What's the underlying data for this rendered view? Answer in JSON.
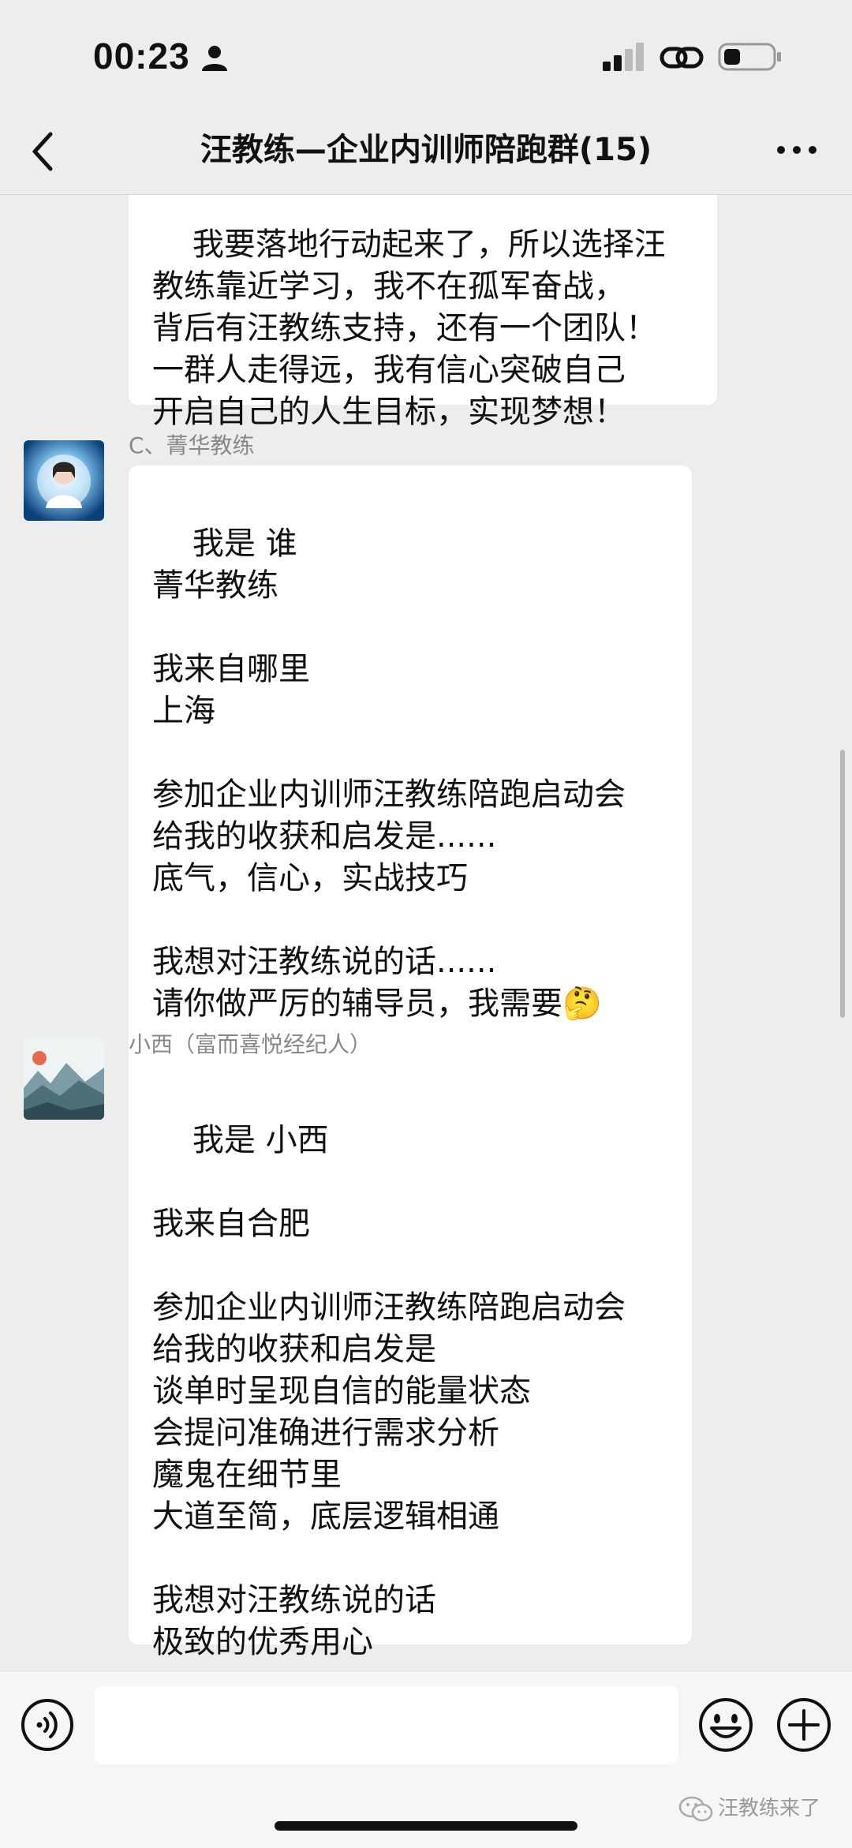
{
  "status_bar": {
    "time": "00:23",
    "icons": [
      "person-icon",
      "signal-icon",
      "link-icon",
      "battery-icon"
    ]
  },
  "nav": {
    "title": "汪教练—企业内训师陪跑群(15)",
    "icons": [
      "back-chevron-icon",
      "more-icon"
    ]
  },
  "messages": [
    {
      "sender": "",
      "text": "我要落地行动起来了，所以选择汪\n教练靠近学习，我不在孤军奋战，\n背后有汪教练支持，还有一个团队！\n一群人走得远，我有信心突破自己\n开启自己的人生目标，实现梦想！"
    },
    {
      "sender": "C、菁华教练",
      "text": "我是 谁\n菁华教练\n\n我来自哪里\n上海\n\n参加企业内训师汪教练陪跑启动会\n给我的收获和启发是......\n底气，信心，实战技巧\n\n我想对汪教练说的话......\n请你做严厉的辅导员，我需要🤔"
    },
    {
      "sender": "小西（富而喜悦经纪人）",
      "text": "我是 小西\n\n我来自合肥\n\n参加企业内训师汪教练陪跑启动会\n给我的收获和启发是\n谈单时呈现自信的能量状态\n会提问准确进行需求分析\n魔鬼在细节里\n大道至简，底层逻辑相通\n\n我想对汪教练说的话\n极致的优秀用心"
    }
  ],
  "input_bar": {
    "icons": [
      "voice-icon",
      "emoji-icon",
      "plus-icon"
    ],
    "text_value": ""
  },
  "watermark": {
    "text": "汪教练来了"
  },
  "colors": {
    "background": "#ededed",
    "bubble": "#ffffff",
    "sender_name": "#888888"
  }
}
